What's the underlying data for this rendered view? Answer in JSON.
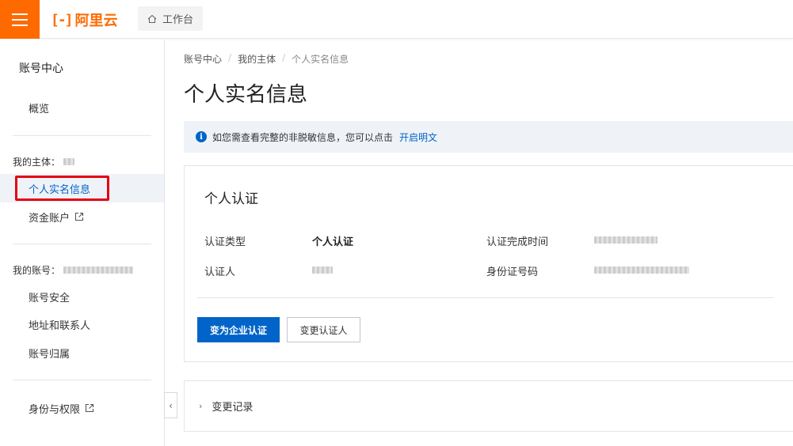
{
  "topbar": {
    "menu_icon": "hamburger-icon",
    "logo_mark": "[-]",
    "logo_text": "阿里云",
    "workbench_icon": "home-icon",
    "workbench_label": "工作台"
  },
  "sidebar": {
    "title": "账号中心",
    "overview": "概览",
    "my_entity_label": "我的主体：",
    "entity_items": [
      {
        "label": "个人实名信息",
        "active": true
      },
      {
        "label": "资金账户",
        "external": true
      }
    ],
    "my_account_label": "我的账号：",
    "account_items": [
      {
        "label": "账号安全"
      },
      {
        "label": "地址和联系人"
      },
      {
        "label": "账号归属"
      }
    ],
    "identity_item": "身份与权限",
    "collapse_icon": "chevron-left-icon"
  },
  "breadcrumb": [
    "账号中心",
    "我的主体",
    "个人实名信息"
  ],
  "page_title": "个人实名信息",
  "notice": {
    "icon": "info-icon",
    "text": "如您需查看完整的非脱敏信息，您可以点击",
    "link": "开启明文"
  },
  "card": {
    "title": "个人认证",
    "fields": {
      "auth_type_label": "认证类型",
      "auth_type_value": "个人认证",
      "completion_time_label": "认证完成时间",
      "person_label": "认证人",
      "id_number_label": "身份证号码"
    },
    "primary_button": "变为企业认证",
    "secondary_button": "变更认证人"
  },
  "change_log": {
    "icon": "chevron-right-icon",
    "label": "变更记录"
  },
  "colors": {
    "brand": "#ff6a00",
    "primary": "#0064c8",
    "highlight": "#e60012",
    "active_bg": "#eff3f8"
  }
}
